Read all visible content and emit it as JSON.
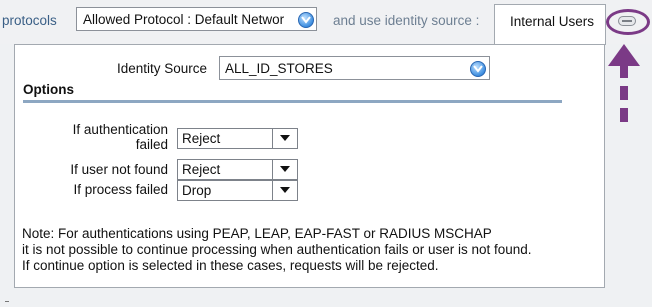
{
  "top": {
    "protocols_label": "protocols",
    "protocol_select_value": "Allowed Protocol : Default Networ",
    "identity_label": "and use identity source :",
    "tab_label": "Internal Users"
  },
  "panel": {
    "identity_source_label": "Identity Source",
    "identity_source_value": "ALL_ID_STORES",
    "options_heading": "Options",
    "rows": [
      {
        "label_lines": [
          "If authentication",
          "failed"
        ],
        "value": "Reject"
      },
      {
        "label_lines": [
          "If user not found"
        ],
        "value": "Reject"
      },
      {
        "label_lines": [
          "If process failed"
        ],
        "value": "Drop"
      }
    ],
    "note_lines": [
      "Note: For authentications using PEAP, LEAP, EAP-FAST or RADIUS MSCHAP",
      "it is not possible to continue processing when authentication fails or user is not found.",
      "If continue option is selected in these cases, requests will be rejected."
    ]
  },
  "icons": {
    "protocol_dropdown": "blue-round-dropdown-icon",
    "identity_dropdown": "blue-round-dropdown-icon",
    "collapse": "collapse-icon",
    "annotation_arrow": "purple-up-arrow-icon"
  },
  "colors": {
    "annotation": "#7b3a86",
    "link_text": "#3a5f86",
    "muted_text": "#6d7f92",
    "rule": "#8da7c2"
  }
}
